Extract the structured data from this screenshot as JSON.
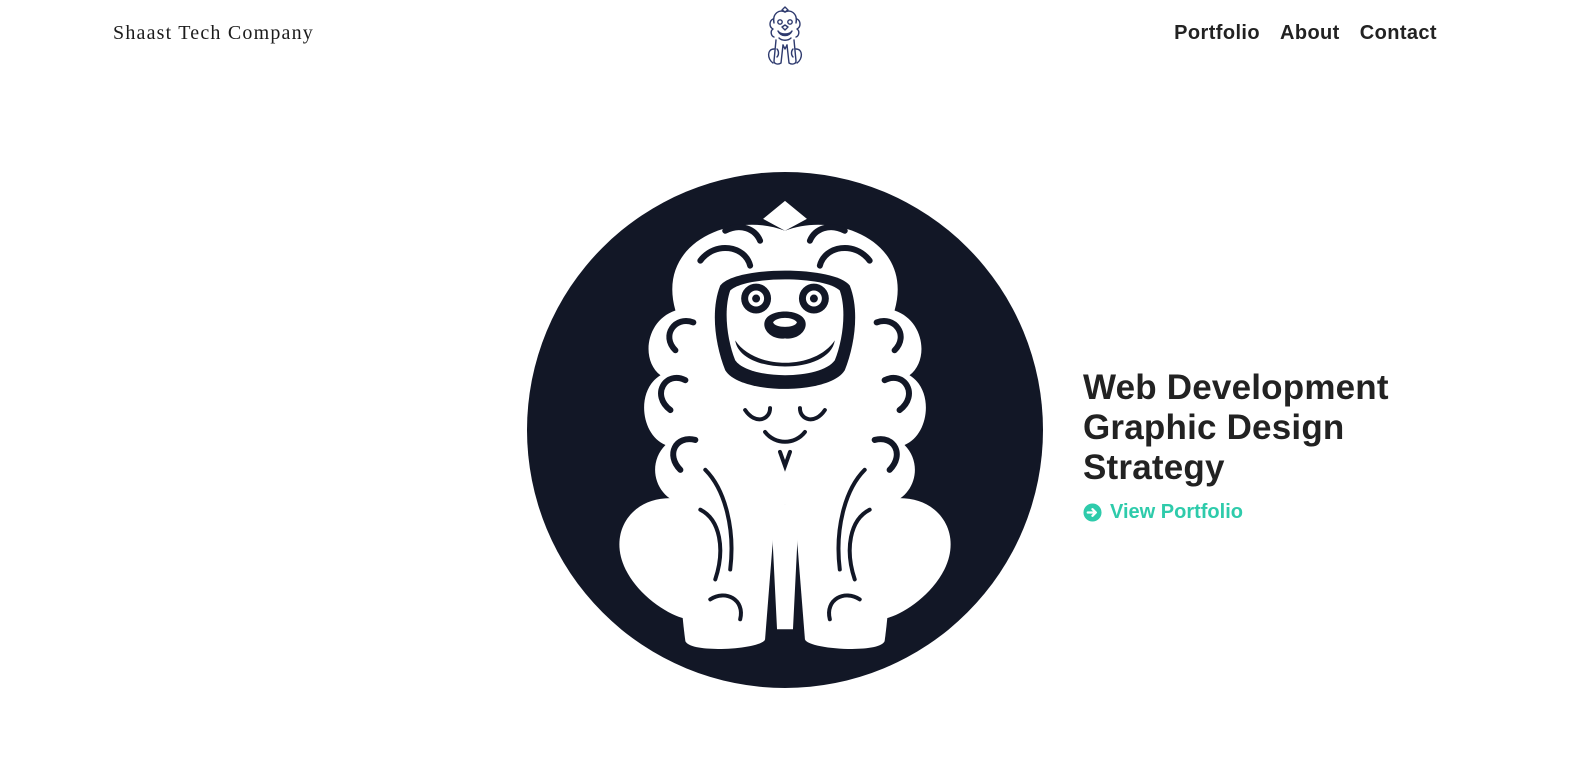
{
  "header": {
    "brand": "Shaast Tech Company",
    "logo_icon": "guardian-lion-icon",
    "nav": [
      {
        "label": "Portfolio"
      },
      {
        "label": "About"
      },
      {
        "label": "Contact"
      }
    ]
  },
  "hero": {
    "emblem_icon": "guardian-lion-icon",
    "services": [
      "Web Development",
      "Graphic Design",
      "Strategy"
    ],
    "cta_label": "View Portfolio",
    "cta_icon": "arrow-circle-right-icon"
  },
  "colors": {
    "accent": "#2ecbab",
    "emblem_background": "#121726",
    "logo_ink": "#2e3a6e",
    "text": "#222222"
  }
}
